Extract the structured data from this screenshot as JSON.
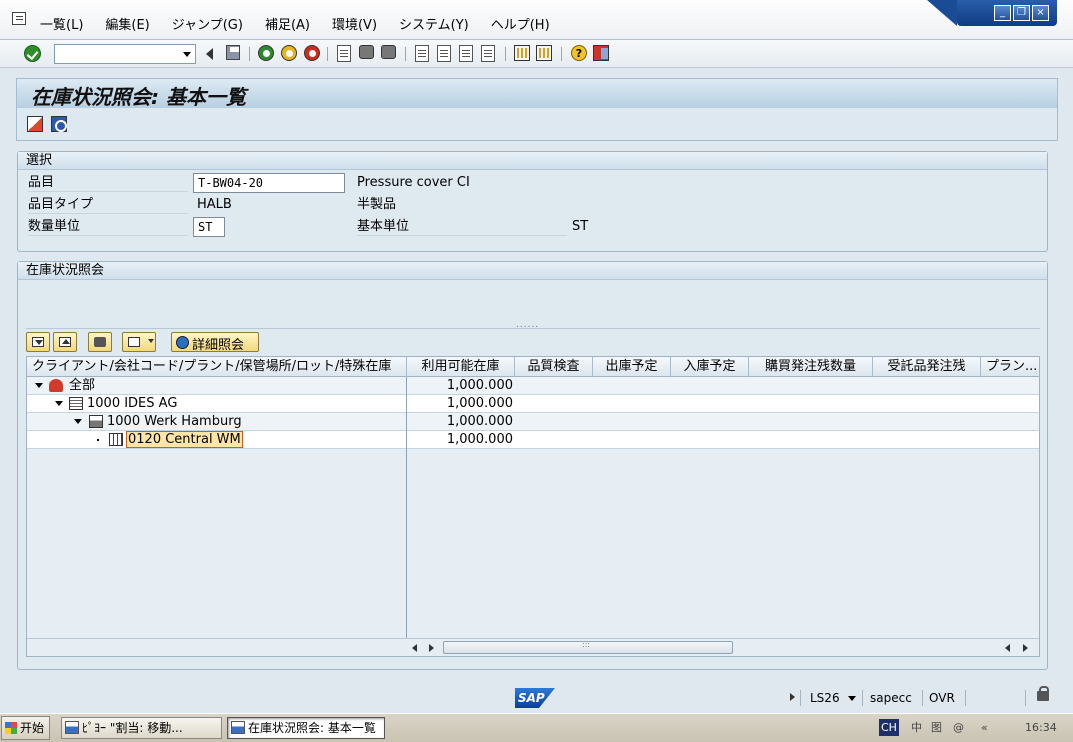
{
  "menubar": {
    "items": [
      "一覧(L)",
      "編集(E)",
      "ジャンプ(G)",
      "補足(A)",
      "環境(V)",
      "システム(Y)",
      "ヘルプ(H)"
    ]
  },
  "window_controls": {
    "minimize": "_",
    "restore": "❐",
    "close": "×"
  },
  "toolbar": {
    "command_field_value": "",
    "icons": [
      "enter-icon",
      "save-icon",
      "back-icon",
      "exit-icon",
      "cancel-icon",
      "print-icon",
      "find-icon",
      "find-next-icon",
      "first-page-icon",
      "previous-page-icon",
      "next-page-icon",
      "last-page-icon",
      "create-session-icon",
      "shortcut-icon",
      "help-icon",
      "layout-icon"
    ]
  },
  "screen": {
    "title": "在庫状況照会: 基本一覧"
  },
  "selection": {
    "title": "選択",
    "material_label": "品目",
    "material_value": "T-BW04-20",
    "material_desc": "Pressure cover CI",
    "material_type_label": "品目タイプ",
    "material_type_value": "HALB",
    "material_type_desc": "半製品",
    "unit_label": "数量単位",
    "unit_value": "ST",
    "base_unit_label": "基本単位",
    "base_unit_value": "ST"
  },
  "inventory": {
    "title": "在庫状況照会",
    "splitter": "......",
    "detail_button": "詳細照会",
    "columns": [
      "クライアント/会社コード/プラント/保管場所/ロット/特殊在庫",
      "利用可能在庫",
      "品質検査",
      "出庫予定",
      "入庫予定",
      "購買発注残数量",
      "受託品発注残",
      "プラン..."
    ],
    "rows": [
      {
        "label": "全部",
        "available": "1,000.000"
      },
      {
        "label": "1000 IDES AG",
        "available": "1,000.000"
      },
      {
        "label": "1000 Werk Hamburg",
        "available": "1,000.000"
      },
      {
        "label": "0120 Central WM",
        "available": "1,000.000"
      }
    ],
    "scroll_grip": ":::"
  },
  "statusbar": {
    "logo": "SAP",
    "system": "LS26",
    "server": "sapecc",
    "mode": "OVR"
  },
  "taskbar": {
    "start": "开始",
    "tasks": [
      "ﾋﾟﾖｰ \"割当: 移動...",
      "在庫状況照会: 基本一覧"
    ],
    "tray": [
      "CH",
      "中",
      "图",
      "@",
      "«",
      "16:34"
    ]
  }
}
